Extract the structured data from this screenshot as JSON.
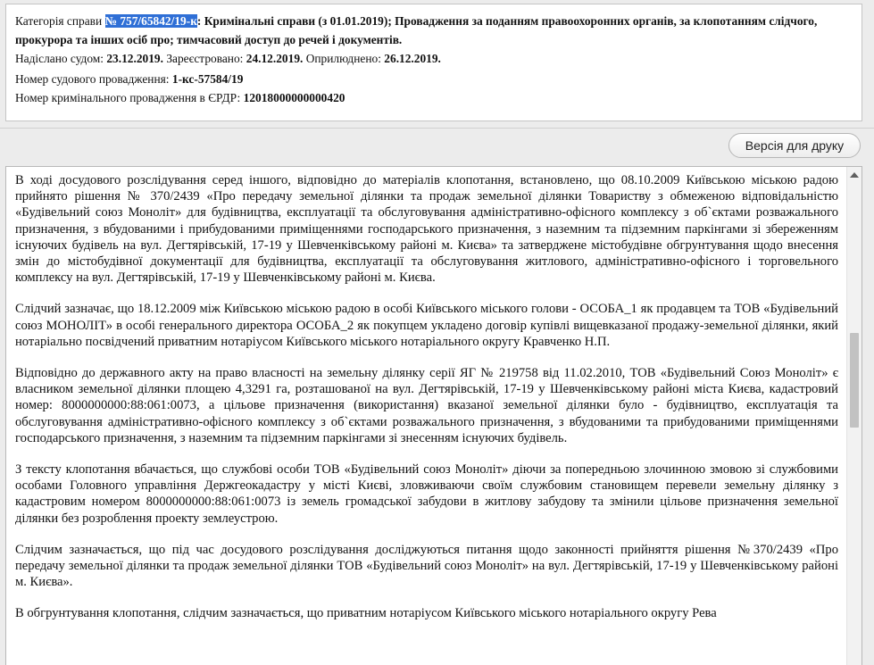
{
  "header": {
    "category_label": "Категорія справи",
    "case_number": "№ 757/65842/19-к",
    "category_text": ": Кримінальні справи (з 01.01.2019); Провадження за поданням правоохоронних органів, за клопотанням слідчого, прокурора та інших осіб про; тимчасовий доступ до речей і документів.",
    "sent_label": "Надіслано судом:",
    "sent_date": "23.12.2019.",
    "registered_label": "Зареєстровано:",
    "registered_date": "24.12.2019.",
    "published_label": "Оприлюднено:",
    "published_date": "26.12.2019.",
    "court_proc_label": "Номер судового провадження:",
    "court_proc_number": "1-кс-57584/19",
    "erdr_label": "Номер кримінального провадження в ЄРДР:",
    "erdr_number": "12018000000000420"
  },
  "toolbar": {
    "print_label": "Версія для друку"
  },
  "document": {
    "paragraphs": [
      "В ході досудового розслідування серед іншого, відповідно до матеріалів клопотання, встановлено, що 08.10.2009 Київською міською радою прийнято рішення № 370/2439 «Про передачу земельної ділянки та продаж земельної ділянки Товариству з обмеженою відповідальністю «Будівельний союз Моноліт» для будівництва, експлуатації та обслуговування адміністративно-офісного комплексу з об`єктами розважального призначення, з вбудованими і прибудованими приміщеннями господарського призначення, з наземним та підземним паркінгами зі збереженням існуючих будівель на вул. Дегтярівській, 17-19 у Шевченківському районі м. Києва» та затверджене містобудівне обгрунтування щодо внесення змін до містобудівної документації для будівництва, експлуатації та обслуговування житлового, адміністративно-офісного і торговельного комплексу на вул. Дегтярівській, 17-19 у Шевченківському районі м. Києва.",
      "Слідчий зазначає, що 18.12.2009 між Київською міською радою в особі Київського міського голови - ОСОБА_1 як продавцем та ТОВ «Будівельний союз МОНОЛІТ» в особі генерального директора ОСОБА_2 як покупцем укладено договір купівлі вищевказаної продажу-земельної ділянки, який нотаріально посвідчений приватним нотаріусом Київського міського нотаріального округу Кравченко Н.П.",
      "Відповідно до державного акту на право власності на земельну ділянку серії ЯГ № 219758 від 11.02.2010, ТОВ «Будівельний Союз Моноліт» є власником земельної ділянки площею 4,3291 га, розташованої на вул. Дегтярівській, 17-19 у Шевченківському районі міста Києва, кадастровий номер: 8000000000:88:061:0073, а цільове призначення (використання) вказаної земельної ділянки було - будівництво, експлуатація та обслуговування адміністративно-офісного комплексу з об`єктами розважального призначення, з вбудованими та прибудованими приміщеннями господарського призначення, з наземним та підземним паркінгами зі знесенням існуючих будівель.",
      "З тексту клопотання вбачається, що службові особи ТОВ «Будівельний союз Моноліт» діючи за попередньою злочинною змовою зі службовими особами Головного управління Держгеокадастру у місті Києві, зловживаючи своїм службовим становищем перевели земельну ділянку з кадастровим номером 8000000000:88:061:0073 із земель громадської забудови в житлову забудову та змінили цільове призначення земельної ділянки без розроблення проекту землеустрою.",
      "Слідчим зазначається, що під час досудового розслідування досліджуються питання щодо законності прийняття рішення №370/2439 «Про передачу земельної ділянки та продаж земельної ділянки ТОВ «Будівельний союз Моноліт» на вул. Дегтярівській, 17-19 у Шевченківському районі м. Києва».",
      "В обгрунтування клопотання, слідчим зазначається, що приватним нотаріусом Київського міського нотаріального округу Рева"
    ]
  }
}
